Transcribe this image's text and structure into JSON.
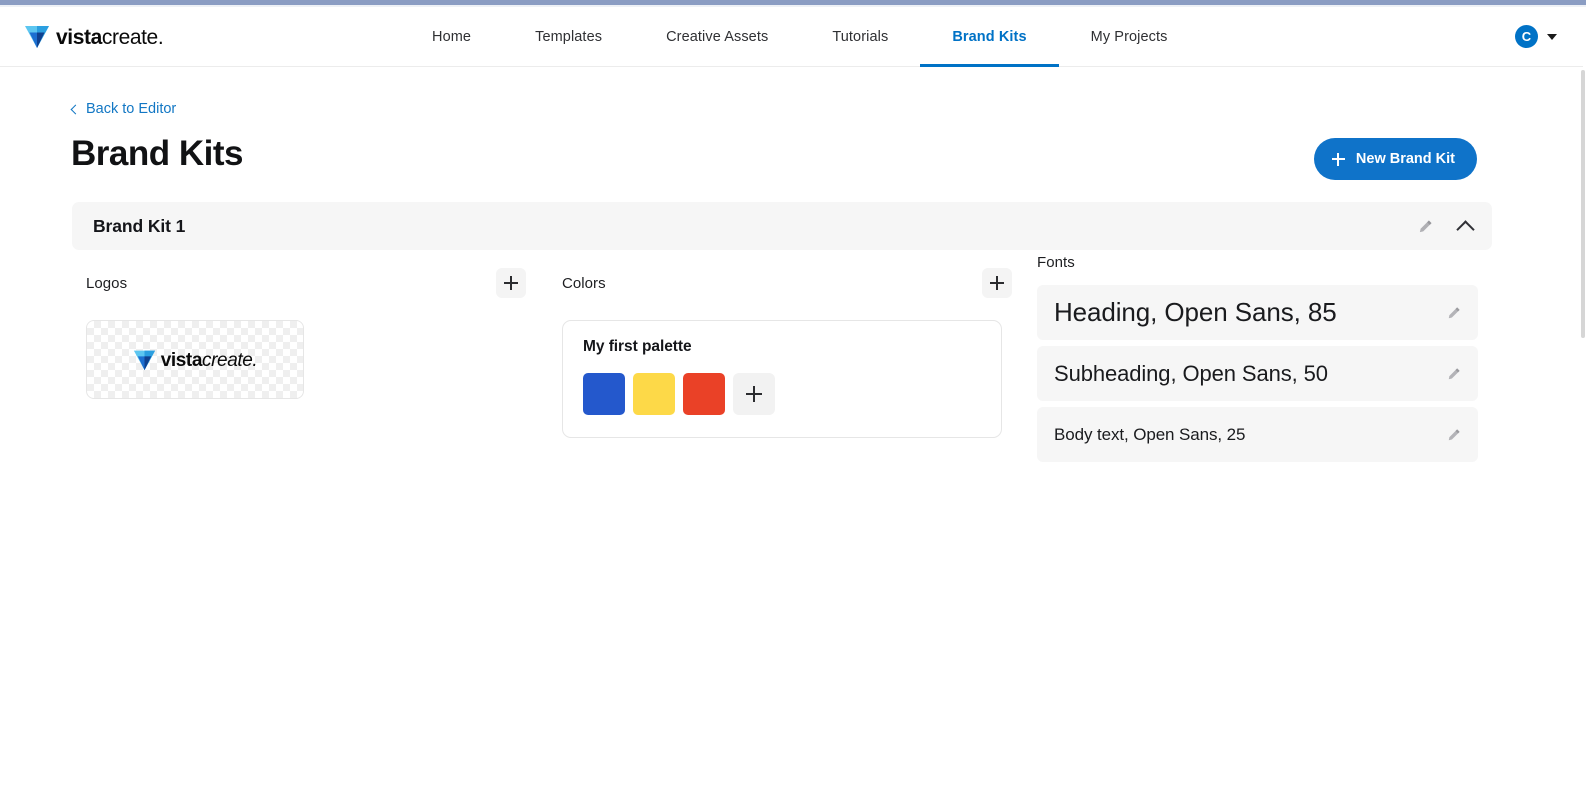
{
  "header": {
    "logo": {
      "mark_icon": "vistacreate-triangle-icon",
      "word_part1": "vista",
      "word_part2": "create",
      "word_suffix": "."
    },
    "nav": [
      {
        "label": "Home",
        "active": false
      },
      {
        "label": "Templates",
        "active": false
      },
      {
        "label": "Creative Assets",
        "active": false
      },
      {
        "label": "Tutorials",
        "active": false
      },
      {
        "label": "Brand Kits",
        "active": true
      },
      {
        "label": "My Projects",
        "active": false
      }
    ],
    "user": {
      "avatar_initial": "C",
      "caret_icon": "chevron-down-icon"
    },
    "active_accent_color": "#0072c6"
  },
  "page": {
    "back_link": "Back to Editor",
    "back_icon": "chevron-left-icon",
    "title": "Brand Kits",
    "new_kit_button": "New Brand Kit",
    "new_kit_icon": "plus-icon",
    "new_kit_color": "#0f73c9"
  },
  "brand_kit": {
    "name": "Brand Kit 1",
    "edit_icon": "pencil-icon",
    "collapse_icon": "chevron-up-icon",
    "logos": {
      "title": "Logos",
      "add_icon": "plus-icon",
      "items": [
        {
          "name": "vistacreate-logo",
          "word_part1": "vista",
          "word_part2": "create",
          "word_suffix": "."
        }
      ]
    },
    "colors": {
      "title": "Colors",
      "add_icon": "plus-icon",
      "palettes": [
        {
          "name": "My first palette",
          "swatches": [
            "#2458cc",
            "#fdd948",
            "#ea4127"
          ],
          "add_swatch_icon": "plus-icon"
        }
      ]
    },
    "fonts": {
      "title": "Fonts",
      "rows": [
        {
          "label": "Heading, Open Sans, 85",
          "edit_icon": "pencil-icon"
        },
        {
          "label": "Subheading, Open Sans, 50",
          "edit_icon": "pencil-icon"
        },
        {
          "label": "Body text, Open Sans, 25",
          "edit_icon": "pencil-icon"
        }
      ]
    }
  }
}
